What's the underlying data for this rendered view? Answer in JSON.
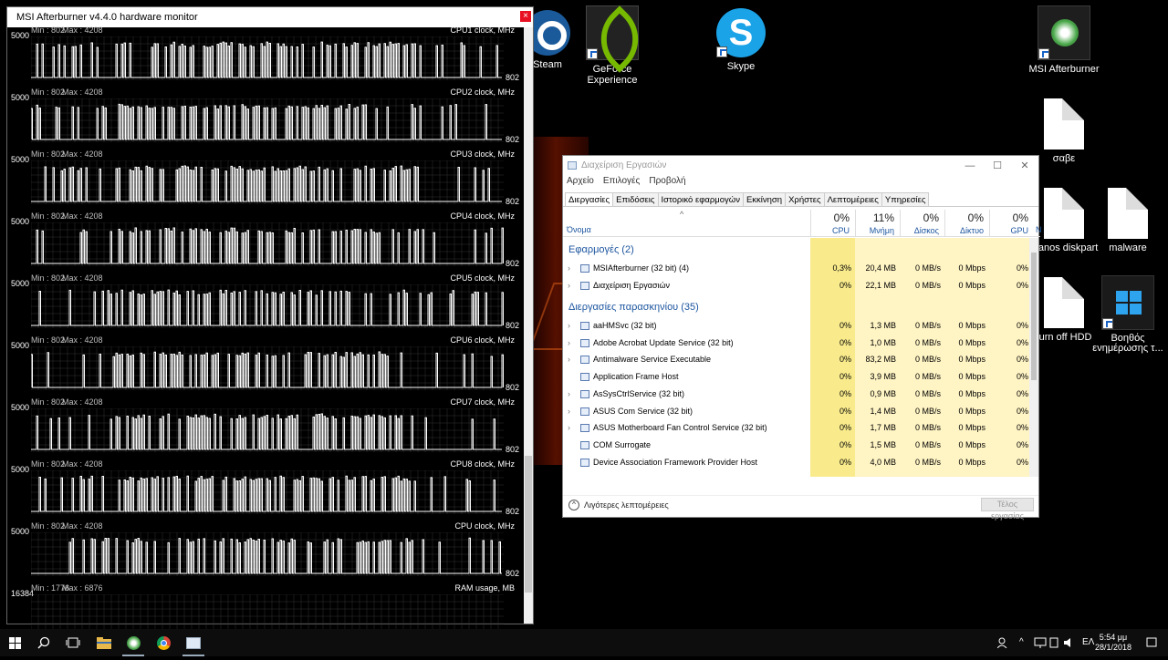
{
  "desktop": {
    "icons": [
      {
        "label": "Steam",
        "icon": "steam-icon"
      },
      {
        "label": "GeForce Experience",
        "icon": "geforce-icon"
      },
      {
        "label": "Skype",
        "icon": "skype-icon"
      },
      {
        "label": "MSI Afterburner",
        "icon": "msi-afterburner-icon"
      },
      {
        "label": "σαβε",
        "icon": "file-icon"
      },
      {
        "label": "thanos diskpart",
        "icon": "file-icon"
      },
      {
        "label": "malware",
        "icon": "file-icon"
      },
      {
        "label": "turn off HDD",
        "icon": "file-icon"
      },
      {
        "label": "Βοηθός ενημέρωσης τ...",
        "icon": "windows-update-icon"
      }
    ]
  },
  "monitor": {
    "title": "MSI Afterburner v4.4.0 hardware monitor",
    "close": "×",
    "graphs": [
      {
        "top_label": "5000",
        "min": "Min : 802",
        "max": "Max : 4208",
        "name": "CPU1 clock, MHz",
        "bottom_value": "802"
      },
      {
        "top_label": "5000",
        "min": "Min : 802",
        "max": "Max : 4208",
        "name": "CPU2 clock, MHz",
        "bottom_value": "802"
      },
      {
        "top_label": "5000",
        "min": "Min : 802",
        "max": "Max : 4208",
        "name": "CPU3 clock, MHz",
        "bottom_value": "802"
      },
      {
        "top_label": "5000",
        "min": "Min : 802",
        "max": "Max : 4208",
        "name": "CPU4 clock, MHz",
        "bottom_value": "802"
      },
      {
        "top_label": "5000",
        "min": "Min : 802",
        "max": "Max : 4208",
        "name": "CPU5 clock, MHz",
        "bottom_value": "802"
      },
      {
        "top_label": "5000",
        "min": "Min : 802",
        "max": "Max : 4208",
        "name": "CPU6 clock, MHz",
        "bottom_value": "802"
      },
      {
        "top_label": "5000",
        "min": "Min : 802",
        "max": "Max : 4208",
        "name": "CPU7 clock, MHz",
        "bottom_value": "802"
      },
      {
        "top_label": "5000",
        "min": "Min : 802",
        "max": "Max : 4208",
        "name": "CPU8 clock, MHz",
        "bottom_value": "802"
      },
      {
        "top_label": "5000",
        "min": "Min : 802",
        "max": "Max : 4208",
        "name": "CPU clock, MHz",
        "bottom_value": "802"
      },
      {
        "top_label": "16384",
        "min": "Min : 1776",
        "max": "Max : 6876",
        "name": "RAM usage, MB",
        "bottom_value": ""
      }
    ]
  },
  "taskmgr": {
    "title": "Διαχείριση Εργασιών",
    "controls": [
      "—",
      "☐",
      "✕"
    ],
    "menu": [
      "Αρχείο",
      "Επιλογές",
      "Προβολή"
    ],
    "tabs": [
      "Διεργασίες",
      "Επιδόσεις",
      "Ιστορικό εφαρμογών",
      "Εκκίνηση",
      "Χρήστες",
      "Λεπτομέρειες",
      "Υπηρεσίες"
    ],
    "name_header": "Όνομα",
    "columns": [
      {
        "pct": "0%",
        "label": "CPU"
      },
      {
        "pct": "11%",
        "label": "Μνήμη"
      },
      {
        "pct": "0%",
        "label": "Δίσκος"
      },
      {
        "pct": "0%",
        "label": "Δίκτυο"
      },
      {
        "pct": "0%",
        "label": "GPU"
      }
    ],
    "extra_col": "N",
    "group_apps": "Εφαρμογές (2)",
    "group_bg": "Διεργασίες παρασκηνίου (35)",
    "apps": [
      {
        "name": "MSIAfterburner (32 bit) (4)",
        "cpu": "0,3%",
        "mem": "20,4 MB",
        "disk": "0 MB/s",
        "net": "0 Mbps",
        "gpu": "0%"
      },
      {
        "name": "Διαχείριση Εργασιών",
        "cpu": "0%",
        "mem": "22,1 MB",
        "disk": "0 MB/s",
        "net": "0 Mbps",
        "gpu": "0%"
      }
    ],
    "background": [
      {
        "name": "aaHMSvc (32 bit)",
        "cpu": "0%",
        "mem": "1,3 MB",
        "disk": "0 MB/s",
        "net": "0 Mbps",
        "gpu": "0%",
        "exp": true
      },
      {
        "name": "Adobe Acrobat Update Service (32 bit)",
        "cpu": "0%",
        "mem": "1,0 MB",
        "disk": "0 MB/s",
        "net": "0 Mbps",
        "gpu": "0%",
        "exp": true
      },
      {
        "name": "Antimalware Service Executable",
        "cpu": "0%",
        "mem": "83,2 MB",
        "disk": "0 MB/s",
        "net": "0 Mbps",
        "gpu": "0%",
        "exp": true
      },
      {
        "name": "Application Frame Host",
        "cpu": "0%",
        "mem": "3,9 MB",
        "disk": "0 MB/s",
        "net": "0 Mbps",
        "gpu": "0%",
        "exp": false
      },
      {
        "name": "AsSysCtrlService (32 bit)",
        "cpu": "0%",
        "mem": "0,9 MB",
        "disk": "0 MB/s",
        "net": "0 Mbps",
        "gpu": "0%",
        "exp": true
      },
      {
        "name": "ASUS Com Service (32 bit)",
        "cpu": "0%",
        "mem": "1,4 MB",
        "disk": "0 MB/s",
        "net": "0 Mbps",
        "gpu": "0%",
        "exp": true
      },
      {
        "name": "ASUS Motherboard Fan Control Service (32 bit)",
        "cpu": "0%",
        "mem": "1,7 MB",
        "disk": "0 MB/s",
        "net": "0 Mbps",
        "gpu": "0%",
        "exp": true
      },
      {
        "name": "COM Surrogate",
        "cpu": "0%",
        "mem": "1,5 MB",
        "disk": "0 MB/s",
        "net": "0 Mbps",
        "gpu": "0%",
        "exp": false
      },
      {
        "name": "Device Association Framework Provider Host",
        "cpu": "0%",
        "mem": "4,0 MB",
        "disk": "0 MB/s",
        "net": "0 Mbps",
        "gpu": "0%",
        "exp": false
      }
    ],
    "fewer_details": "Λιγότερες λεπτομέρειες",
    "end_task": "Τέλος εργασίας"
  },
  "taskbar": {
    "language": "ΕΛ",
    "time": "5:54 μμ",
    "date": "28/1/2018"
  },
  "colors": {
    "accent": "#1e56a0",
    "tm_highlight": "#fff4c4"
  }
}
